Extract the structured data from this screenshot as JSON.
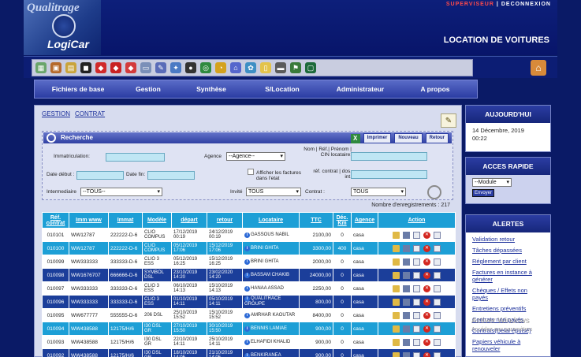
{
  "header": {
    "logo_top": "Qualitrage",
    "logo_bottom": "LogiCar",
    "user_role": "SUPERVISEUR",
    "separator": "|",
    "logout": "DECONNEXION",
    "app_title": "LOCATION DE VOITURES"
  },
  "nav": [
    "Fichiers de base",
    "Gestion",
    "Synthèse",
    "S/Location",
    "Administrateur",
    "A propos"
  ],
  "breadcrumb": [
    "GESTION",
    "CONTRAT"
  ],
  "search": {
    "title": "Recherche",
    "buttons": [
      "Imprimer",
      "Nouveau",
      "Retour"
    ],
    "labels": {
      "immat": "Immatriculation:",
      "agence": "Agence",
      "nom": "Nom | Réf.| Prénom | CIN locataire:",
      "date_debut": "Date début :",
      "date_fin": "Date fin:",
      "afficher": "Afficher les factures dans l'etat",
      "ref": "réf. contrat | dos. int.",
      "intermediaire": "Intermediaire",
      "invite": "Invité",
      "contrat": "Contrat :"
    },
    "agence_value": "--Agence--",
    "intermediaire_value": "--TOUS--",
    "invite_value": "TOUS",
    "contrat_value": "TOUS"
  },
  "count_text": "Nombre d'enregistrements : 217",
  "table": {
    "headers": [
      "Réf. contrat",
      "Imm www",
      "Immat",
      "Modèle",
      "départ",
      "retour",
      "Locataire",
      "TTC",
      "Déc. Km",
      "Agence",
      "Action"
    ],
    "rows": [
      {
        "ref": "010101",
        "immw": "WW12787",
        "immat": "222222-D-6",
        "modele": "CLIO COMPUS",
        "depart": "17/12/2019 00:19",
        "retour": "24/12/2019 00:19",
        "locataire": "GASSOUS NABIL",
        "ttc": "2100,00",
        "km": "0",
        "agence": "casa"
      },
      {
        "ref": "010100",
        "immw": "WW12787",
        "immat": "222222-D-6",
        "modele": "CLIO COMPUS",
        "depart": "05/12/2019 17:06",
        "retour": "15/12/2019 17:06",
        "locataire": "BRINI GHITA",
        "ttc": "3300,00",
        "km": "400",
        "agence": "casa"
      },
      {
        "ref": "010099",
        "immw": "WW333333",
        "immat": "333333-D-6",
        "modele": "CLIO 3 ESS",
        "depart": "05/12/2019 16:25",
        "retour": "15/12/2019 16:25",
        "locataire": "BRINI GHITA",
        "ttc": "2000,00",
        "km": "0",
        "agence": "casa"
      },
      {
        "ref": "010098",
        "immw": "WW1676707",
        "immat": "666666-D-6",
        "modele": "SYMBOL DSL",
        "depart": "23/10/2019 14:20",
        "retour": "23/02/2020 14:20",
        "locataire": "BASSAM CHAKIB",
        "ttc": "24000,00",
        "km": "0",
        "agence": "casa"
      },
      {
        "ref": "010097",
        "immw": "WW333333",
        "immat": "333333-D-6",
        "modele": "CLIO 3 ESS",
        "depart": "06/10/2019 14:13",
        "retour": "15/10/2019 14:13",
        "locataire": "HANAA ASSAD",
        "ttc": "2250,00",
        "km": "0",
        "agence": "casa"
      },
      {
        "ref": "010096",
        "immw": "WW333333",
        "immat": "333333-D-6",
        "modele": "CLIO 3 ESS",
        "depart": "01/10/2019 14:11",
        "retour": "05/10/2019 14:11",
        "locataire": "QUALITRACE GROUPE",
        "ttc": "800,00",
        "km": "0",
        "agence": "casa"
      },
      {
        "ref": "010095",
        "immw": "WW677777",
        "immat": "555555-D-6",
        "modele": "206 DSL",
        "depart": "25/10/2019 15:52",
        "retour": "15/10/2019 15:52",
        "locataire": "AMRHAR KAOUTAR",
        "ttc": "8400,00",
        "km": "0",
        "agence": "casa"
      },
      {
        "ref": "010094",
        "immw": "WW438588",
        "immat": "12175/H/6",
        "modele": "I30 DSL GR",
        "depart": "27/10/2019 15:50",
        "retour": "30/10/2019 15:50",
        "locataire": "BENNIS LAMIAE",
        "ttc": "900,00",
        "km": "0",
        "agence": "casa"
      },
      {
        "ref": "010093",
        "immw": "WW438588",
        "immat": "12175/H/6",
        "modele": "I30 DSL GR",
        "depart": "22/10/2019 14:11",
        "retour": "25/10/2019 14:11",
        "locataire": "ELHAFIDI KHALID",
        "ttc": "900,00",
        "km": "0",
        "agence": "casa"
      },
      {
        "ref": "010092",
        "immw": "WW438588",
        "immat": "12175/H/6",
        "modele": "I30 DSL GR",
        "depart": "18/10/2019 14:05",
        "retour": "21/10/2019 14:05",
        "locataire": "BENKIRANEA",
        "ttc": "900,00",
        "km": "0",
        "agence": "casa"
      }
    ]
  },
  "right": {
    "today_title": "AUJOURD'HUI",
    "today_date": "14 Décembre, 2019",
    "today_time": "00:22",
    "acces_title": "ACCES RAPIDE",
    "module_value": "--Module",
    "envoyer": "Envoyer",
    "alertes_title": "ALERTES",
    "alertes": [
      "Validation retour",
      "Tâches dépassées",
      "Réglement par client",
      "Factures en instance à générer",
      "Chèques / Effets non payés",
      "Entretiens préventifs",
      "Contrats non payés",
      "Contrats(Delai épuisé)",
      "Papiers véhicule à renouveler"
    ]
  },
  "watermark": {
    "line1": "Activer Windows",
    "line2": "Accédez aux paramètres"
  },
  "colors": {
    "accent": "#1d9fd6",
    "dark": "#0a1a66",
    "nav": "#2b3da3",
    "danger": "#d3261f"
  },
  "icons": [
    "image-icon",
    "box-icon",
    "folder-icon",
    "car-black-icon",
    "car-red-icon",
    "car-red2-icon",
    "car-red3-icon",
    "window-icon",
    "pen-icon",
    "tools-icon",
    "tire-icon",
    "target-icon",
    "clock-icon",
    "house-icon",
    "settings-icon",
    "note-icon",
    "gun-icon",
    "flag-icon",
    "screen-icon"
  ]
}
